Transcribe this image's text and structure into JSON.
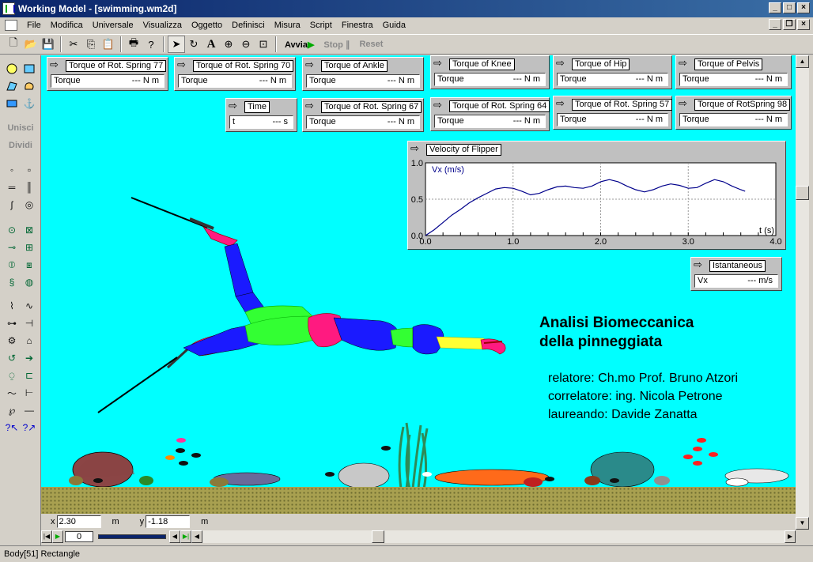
{
  "window": {
    "title": "Working Model - [swimming.wm2d]"
  },
  "menu": [
    "File",
    "Modifica",
    "Universale",
    "Visualizza",
    "Oggetto",
    "Definisci",
    "Misura",
    "Script",
    "Finestra",
    "Guida"
  ],
  "toolbar": {
    "run": "Avvia",
    "stop": "Stop",
    "reset": "Reset"
  },
  "leftbar": {
    "join": "Unisci",
    "split": "Dividi"
  },
  "meters": [
    {
      "title": "Torque of Rot. Spring 77",
      "label": "Torque",
      "value": "--- N m"
    },
    {
      "title": "Torque of Rot. Spring 70",
      "label": "Torque",
      "value": "--- N m"
    },
    {
      "title": "Torque of Ankle",
      "label": "Torque",
      "value": "--- N m"
    },
    {
      "title": "Torque of Knee",
      "label": "Torque",
      "value": "--- N m"
    },
    {
      "title": "Torque of Hip",
      "label": "Torque",
      "value": "--- N m"
    },
    {
      "title": "Torque of Pelvis",
      "label": "Torque",
      "value": "--- N m"
    },
    {
      "title": "Time",
      "label": "t",
      "value": "--- s"
    },
    {
      "title": "Torque of Rot. Spring 67",
      "label": "Torque",
      "value": "--- N m"
    },
    {
      "title": "Torque of Rot. Spring 64",
      "label": "Torque",
      "value": "--- N m"
    },
    {
      "title": "Torque of Rot. Spring 57",
      "label": "Torque",
      "value": "--- N m"
    },
    {
      "title": "Torque of RotSpring 98",
      "label": "Torque",
      "value": "--- N m"
    },
    {
      "title": "Istantaneous",
      "label": "Vx",
      "value": "--- m/s"
    }
  ],
  "graph": {
    "title": "Velocity of Flipper"
  },
  "chart_data": {
    "type": "line",
    "ylabel": "Vx (m/s)",
    "xlabel": "t (s)",
    "xlim": [
      0,
      4.0
    ],
    "ylim": [
      0,
      1.0
    ],
    "xticks": [
      "0.0",
      "1.0",
      "2.0",
      "3.0",
      "4.0"
    ],
    "yticks": [
      "0.0",
      "0.5",
      "1.0"
    ],
    "grid": true,
    "x": [
      0.0,
      0.1,
      0.2,
      0.3,
      0.4,
      0.5,
      0.6,
      0.7,
      0.8,
      0.9,
      1.0,
      1.1,
      1.2,
      1.3,
      1.4,
      1.5,
      1.6,
      1.7,
      1.8,
      1.9,
      2.0,
      2.1,
      2.2,
      2.3,
      2.4,
      2.5,
      2.6,
      2.7,
      2.8,
      2.9,
      3.0,
      3.1,
      3.2,
      3.3,
      3.4,
      3.5,
      3.6,
      3.65
    ],
    "y": [
      0.0,
      0.08,
      0.18,
      0.28,
      0.36,
      0.45,
      0.52,
      0.58,
      0.64,
      0.66,
      0.65,
      0.61,
      0.56,
      0.58,
      0.63,
      0.67,
      0.68,
      0.66,
      0.65,
      0.68,
      0.74,
      0.77,
      0.74,
      0.68,
      0.63,
      0.6,
      0.63,
      0.68,
      0.71,
      0.69,
      0.65,
      0.66,
      0.72,
      0.77,
      0.74,
      0.68,
      0.63,
      0.61
    ]
  },
  "heading": {
    "line1": "Analisi Biomeccanica",
    "line2": "della pinneggiata"
  },
  "credits": [
    "relatore: Ch.mo Prof. Bruno Atzori",
    "correlatore: ing. Nicola Petrone",
    "laureando: Davide Zanatta"
  ],
  "coords": {
    "x_label": "x",
    "x_value": "2.30",
    "x_unit": "m",
    "y_label": "y",
    "y_value": "-1.18",
    "y_unit": "m"
  },
  "frame_counter": "0",
  "status": "Body[51]  Rectangle",
  "colors": {
    "water": "#00ffff",
    "seabed": "#a8a050",
    "body_blue": "#1a1aff",
    "body_green": "#33ff33",
    "body_pink": "#ff1a80",
    "cap_yellow": "#ffff33"
  }
}
